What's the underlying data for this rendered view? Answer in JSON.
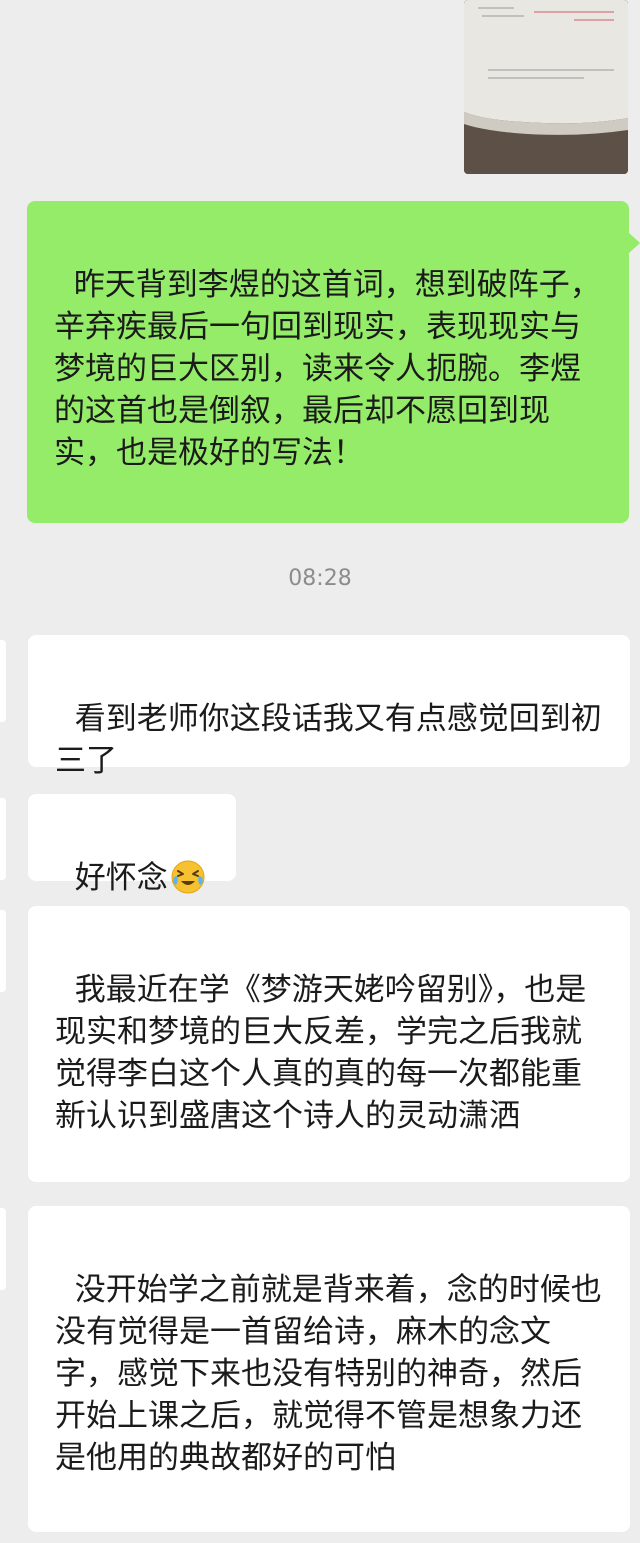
{
  "chat": {
    "sent_image_alt": "",
    "outgoing_message": "昨天背到李煜的这首词，想到破阵子，辛弃疾最后一句回到现实，表现现实与梦境的巨大区别，读来令人扼腕。李煜的这首也是倒叙，最后却不愿回到现实，也是极好的写法！",
    "timestamp": "08:28",
    "incoming_messages": [
      {
        "text": "看到老师你这段话我又有点感觉回到初三了"
      },
      {
        "text": "好怀念",
        "emoji": "crying-laughing-emoji"
      },
      {
        "text": "我最近在学《梦游天姥吟留别》，也是现实和梦境的巨大反差，学完之后我就觉得李白这个人真的真的每一次都能重新认识到盛唐这个诗人的灵动潇洒"
      },
      {
        "text": "没开始学之前就是背来着，念的时候也没有觉得是一首留给诗，麻木的念文字，感觉下来也没有特别的神奇，然后开始上课之后，就觉得不管是想象力还是他用的典故都好的可怕"
      }
    ],
    "colors": {
      "background": "#ededed",
      "outgoing_bubble": "#95ec69",
      "incoming_bubble": "#ffffff",
      "timestamp_text": "#8c8c8c"
    }
  }
}
